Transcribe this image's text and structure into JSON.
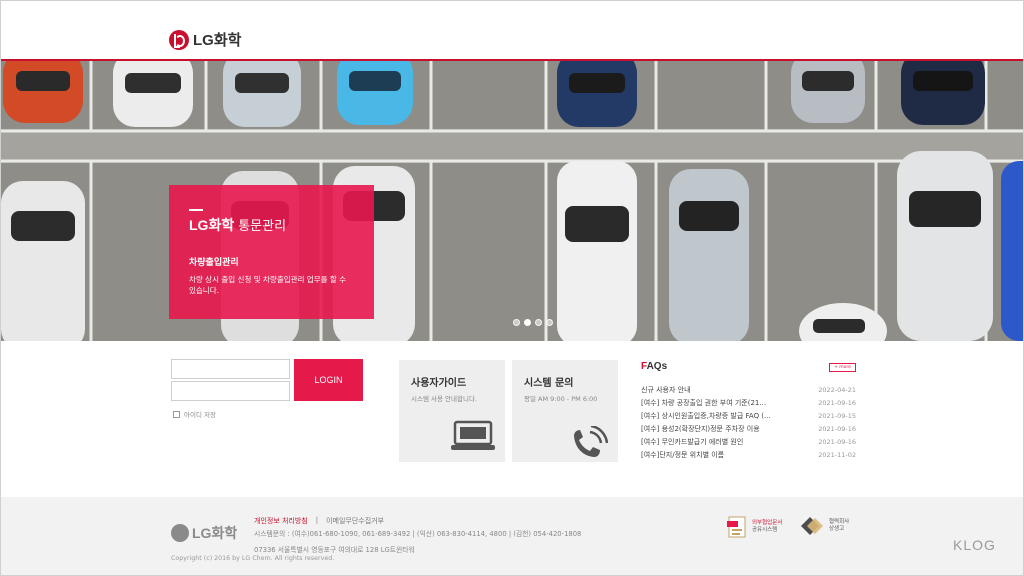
{
  "header": {
    "logo_text": "LG화학"
  },
  "hero": {
    "promo_brand": "LG화학",
    "promo_title": "통문관리",
    "promo_subtitle": "차량출입관리",
    "promo_description": "차량 상시 출입 신청 및 차량출입관리 업무를 할 수 있습니다."
  },
  "login": {
    "id_placeholder": "",
    "password_placeholder": "",
    "button_label": "LOGIN",
    "save_id_label": "아이디 저장"
  },
  "cards": {
    "guide_title": "사용자가이드",
    "guide_desc": "시스템 사용 안내합니다.",
    "inquiry_title": "시스템 문의",
    "inquiry_desc": "평일 AM 9:00 - PM 6:00"
  },
  "faq": {
    "title_first": "F",
    "title_rest": "AQs",
    "more_label": "+ more",
    "items": [
      {
        "title": "신규 사용자 안내",
        "date": "2022-04-21"
      },
      {
        "title": "[여수] 차량 공장출입 권한 부여 기준(21...",
        "date": "2021-09-16"
      },
      {
        "title": "[여수] 상시인원출입증,차량증 발급 FAQ (...",
        "date": "2021-09-15"
      },
      {
        "title": "[여수] 용성2(확장단지)정문 주차장 이용",
        "date": "2021-09-16"
      },
      {
        "title": "[여수] 무인카드발급기 에러별 원인",
        "date": "2021-09-16"
      },
      {
        "title": "[여수]단지/정문 위치별 이름",
        "date": "2021-11-02"
      }
    ]
  },
  "footer": {
    "logo_text": "LG화학",
    "privacy_link": "개인정보 처리방침",
    "separator": "|",
    "email_link": "이메일무단수집거부",
    "contact": "시스템문의 : (여수)061-680-1090, 061-689-3492 | (익산) 063-830-4114, 4800 | (김천) 054-420-1808",
    "address": "07336 서울특별시 영등포구 여의대로 128 LG트윈타워",
    "copyright": "Copyright (c) 2016 by LG Chem. All rights reserved.",
    "badge1_line1": "외부협업문서",
    "badge1_line2": "공유시스템",
    "badge2_line1": "협력회사",
    "badge2_line2": "상생고"
  },
  "watermark": "KLOG",
  "colors": {
    "accent": "#e6194b",
    "brand": "#c8102e",
    "card_bg": "#eeeeee",
    "footer_bg": "#f2f2f2"
  }
}
